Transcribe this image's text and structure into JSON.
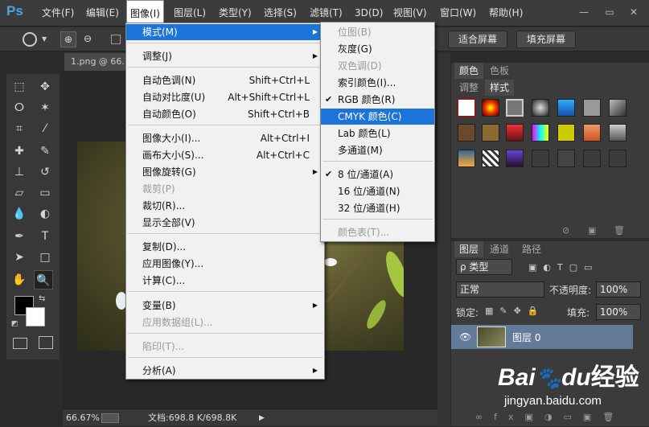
{
  "app": {
    "logo": "Ps"
  },
  "menubar": [
    {
      "label": "文件(F)"
    },
    {
      "label": "编辑(E)"
    },
    {
      "label": "图像(I)"
    },
    {
      "label": "图层(L)"
    },
    {
      "label": "类型(Y)"
    },
    {
      "label": "选择(S)"
    },
    {
      "label": "滤镜(T)"
    },
    {
      "label": "3D(D)"
    },
    {
      "label": "视图(V)"
    },
    {
      "label": "窗口(W)"
    },
    {
      "label": "帮助(H)"
    }
  ],
  "window_controls": {
    "minimize": "—",
    "restore": "▭",
    "close": "✕"
  },
  "options_bar": {
    "fit_screen": "适合屏幕",
    "fill_screen": "填充屏幕"
  },
  "document": {
    "tab_title": "1.png @ 66.7",
    "zoom": "66.67%",
    "doc_info": "文档:698.8 K/698.8K"
  },
  "image_menu": {
    "mode": "模式(M)",
    "adjust": "调整(J)",
    "auto_tone": "自动色调(N)",
    "auto_tone_sc": "Shift+Ctrl+L",
    "auto_contrast": "自动对比度(U)",
    "auto_contrast_sc": "Alt+Shift+Ctrl+L",
    "auto_color": "自动颜色(O)",
    "auto_color_sc": "Shift+Ctrl+B",
    "image_size": "图像大小(I)...",
    "image_size_sc": "Alt+Ctrl+I",
    "canvas_size": "画布大小(S)...",
    "canvas_size_sc": "Alt+Ctrl+C",
    "rotation": "图像旋转(G)",
    "crop": "裁剪(P)",
    "trim": "裁切(R)...",
    "reveal_all": "显示全部(V)",
    "duplicate": "复制(D)...",
    "apply_image": "应用图像(Y)...",
    "calculations": "计算(C)...",
    "variables": "变量(B)",
    "apply_dataset": "应用数据组(L)...",
    "trap": "陷印(T)...",
    "analysis": "分析(A)"
  },
  "mode_menu": {
    "bitmap": "位图(B)",
    "grayscale": "灰度(G)",
    "duotone": "双色调(D)",
    "indexed": "索引颜色(I)...",
    "rgb": "RGB 颜色(R)",
    "cmyk": "CMYK 颜色(C)",
    "lab": "Lab 颜色(L)",
    "multichannel": "多通道(M)",
    "bit8": "8 位/通道(A)",
    "bit16": "16 位/通道(N)",
    "bit32": "32 位/通道(H)",
    "color_table": "颜色表(T)...",
    "check": "✔"
  },
  "color_panel": {
    "tab_color": "颜色",
    "tab_swatches": "色板",
    "tab_adjust": "调整",
    "tab_styles": "样式"
  },
  "layers_panel": {
    "tab_layers": "图层",
    "tab_channels": "通道",
    "tab_paths": "路径",
    "kind_filter": "ρ 类型",
    "blend_mode": "正常",
    "opacity_label": "不透明度:",
    "opacity_value": "100%",
    "lock_label": "锁定:",
    "fill_label": "填充:",
    "fill_value": "100%",
    "layer_name": "图层 0"
  },
  "watermark": {
    "brand": "Bai",
    "brand2": "du",
    "service": "经验",
    "url": "jingyan.baidu.com"
  },
  "colors": {
    "highlight": "#1c74d8",
    "menu_bg": "#f1f1f1",
    "ui_dark": "#3c3c3c",
    "layer_selected": "#637a98"
  }
}
